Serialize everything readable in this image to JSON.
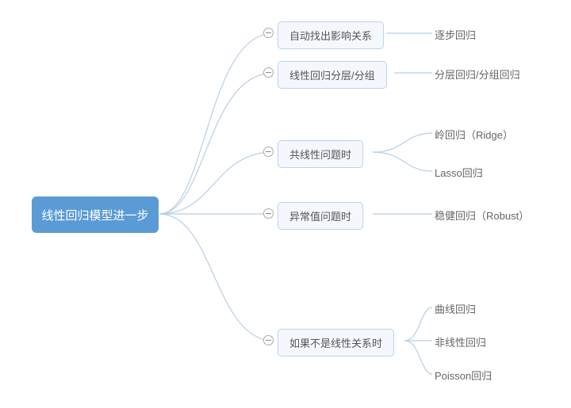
{
  "root": {
    "label": "线性回归模型进一步"
  },
  "branches": [
    {
      "id": "b1",
      "label": "自动找出影响关系",
      "leaves": [
        {
          "id": "l1a",
          "label": "逐步回归"
        }
      ]
    },
    {
      "id": "b2",
      "label": "线性回归分层/分组",
      "leaves": [
        {
          "id": "l2a",
          "label": "分层回归/分组回归"
        }
      ]
    },
    {
      "id": "b3",
      "label": "共线性问题时",
      "leaves": [
        {
          "id": "l3a",
          "label": "岭回归（Ridge）"
        },
        {
          "id": "l3b",
          "label": "Lasso回归"
        }
      ]
    },
    {
      "id": "b4",
      "label": "异常值问题时",
      "leaves": [
        {
          "id": "l4a",
          "label": "稳健回归（Robust）"
        }
      ]
    },
    {
      "id": "b5",
      "label": "如果不是线性关系时",
      "leaves": [
        {
          "id": "l5a",
          "label": "曲线回归"
        },
        {
          "id": "l5b",
          "label": "非线性回归"
        },
        {
          "id": "l5c",
          "label": "Poisson回归"
        }
      ]
    }
  ],
  "colors": {
    "root_bg": "#5b9bd5",
    "branch_bg": "#f4f8fc",
    "branch_border": "#bcd3eb",
    "connector": "#b9cfe6"
  }
}
